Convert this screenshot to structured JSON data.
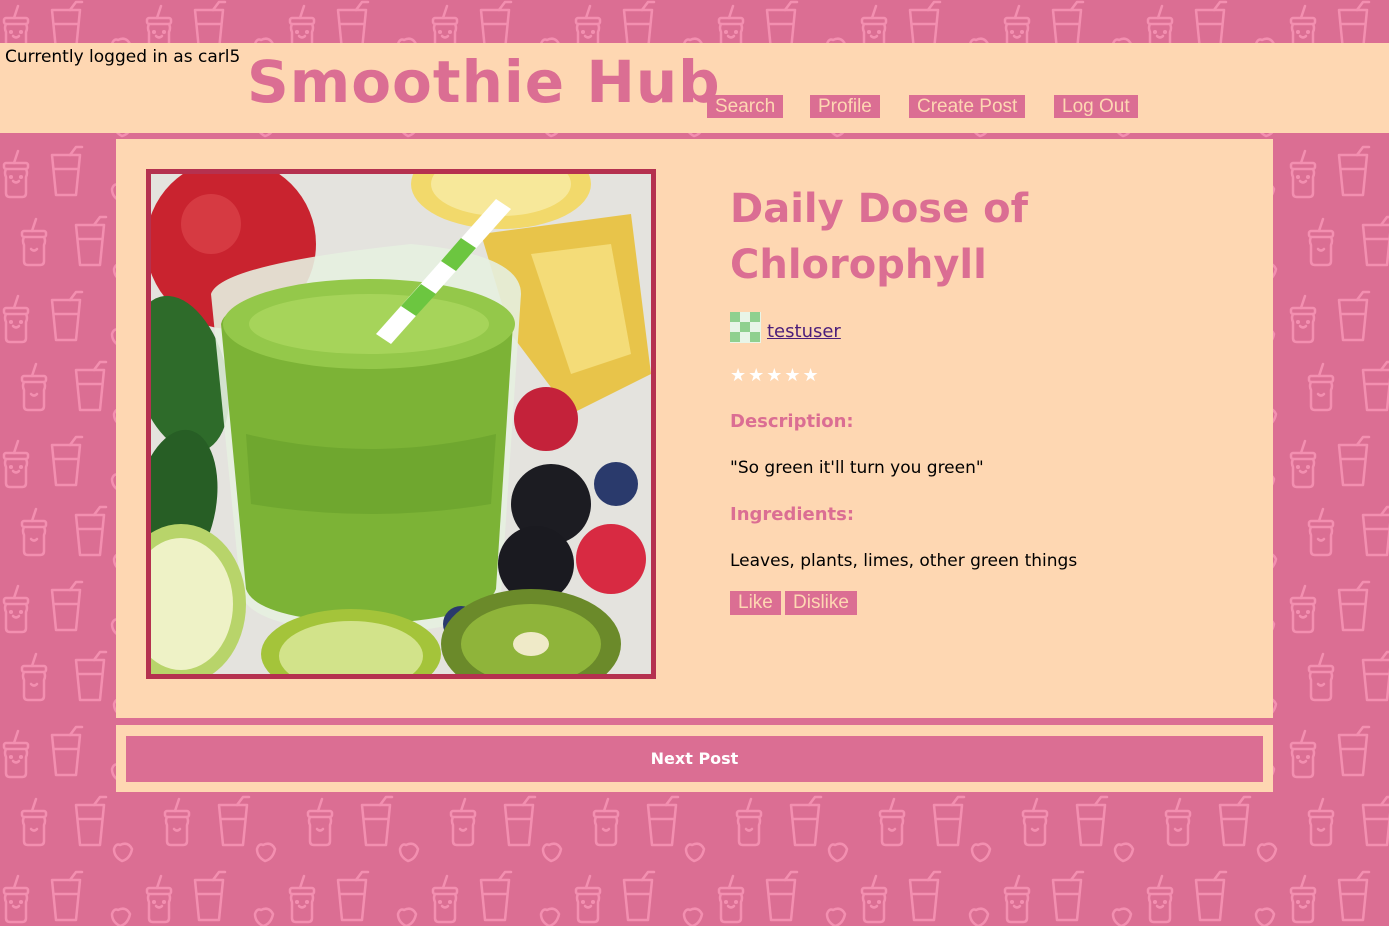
{
  "session": {
    "logged_in_text": "Currently logged in as carl5"
  },
  "header": {
    "site_title": "Smoothie Hub",
    "nav": {
      "search": "Search",
      "profile": "Profile",
      "create_post": "Create Post",
      "log_out": "Log Out"
    }
  },
  "post": {
    "image_icon": "green-smoothie-photo",
    "title": "Daily Dose of Chlorophyll",
    "author": "testuser",
    "rating_stars": "★★★★★",
    "description_label": "Description:",
    "description": "\"So green it'll turn you green\"",
    "ingredients_label": "Ingredients:",
    "ingredients": "Leaves, plants, limes, other green things",
    "like_label": "Like",
    "dislike_label": "Dislike"
  },
  "footer": {
    "next_post_label": "Next Post"
  },
  "colors": {
    "brand_pink": "#db6e93",
    "peach": "#fed7b2",
    "frame": "#b5314f",
    "link": "#4b1d7a"
  }
}
